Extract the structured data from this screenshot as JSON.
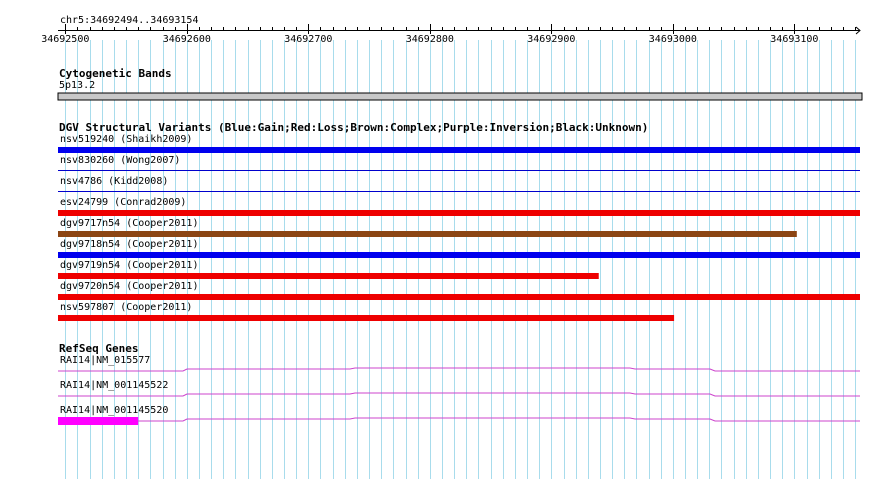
{
  "region": {
    "label": "chr5:34692494..34693154",
    "start": 34692494,
    "end": 34693154
  },
  "ruler": {
    "ticks": [
      "34692500",
      "34692600",
      "34692700",
      "34692800",
      "34692900",
      "34693000",
      "34693100"
    ]
  },
  "cytobands": {
    "title": "Cytogenetic Bands",
    "band": "5p13.2",
    "color": "#c8c8c8"
  },
  "dgv": {
    "title": "DGV Structural Variants (Blue:Gain;Red:Loss;Brown:Complex;Purple:Inversion;Black:Unknown)",
    "colors": {
      "gain": "#0000ee",
      "loss": "#ee0000",
      "complex": "#8b4513",
      "thin": "#0000cc"
    },
    "variants": [
      {
        "label": "nsv519240 (Shaikh2009)",
        "type": "gain",
        "style": "thick",
        "start": 34692494,
        "end": 34693154
      },
      {
        "label": "nsv830260 (Wong2007)",
        "type": "gain",
        "style": "thin",
        "start": 34692494,
        "end": 34693154
      },
      {
        "label": "nsv4786 (Kidd2008)",
        "type": "gain",
        "style": "thin",
        "start": 34692494,
        "end": 34693154
      },
      {
        "label": "esv24799 (Conrad2009)",
        "type": "loss",
        "style": "thick",
        "start": 34692494,
        "end": 34693154
      },
      {
        "label": "dgv9717n54 (Cooper2011)",
        "type": "complex",
        "style": "thick",
        "start": 34692494,
        "end": 34693102
      },
      {
        "label": "dgv9718n54 (Cooper2011)",
        "type": "gain",
        "style": "thick",
        "start": 34692494,
        "end": 34693154
      },
      {
        "label": "dgv9719n54 (Cooper2011)",
        "type": "loss",
        "style": "thick",
        "start": 34692494,
        "end": 34692939
      },
      {
        "label": "dgv9720n54 (Cooper2011)",
        "type": "loss",
        "style": "thick",
        "start": 34692494,
        "end": 34693154
      },
      {
        "label": "nsv597807 (Cooper2011)",
        "type": "loss",
        "style": "thick",
        "start": 34692494,
        "end": 34693001
      }
    ]
  },
  "refseq": {
    "title": "RefSeq Genes",
    "color": "#cc44cc",
    "exon_color": "#ff00ff",
    "genes": [
      {
        "label": "RAI14|NM_015577"
      },
      {
        "label": "RAI14|NM_001145522"
      },
      {
        "label": "RAI14|NM_001145520",
        "exon_start": 34692494,
        "exon_end": 34692560
      }
    ]
  }
}
